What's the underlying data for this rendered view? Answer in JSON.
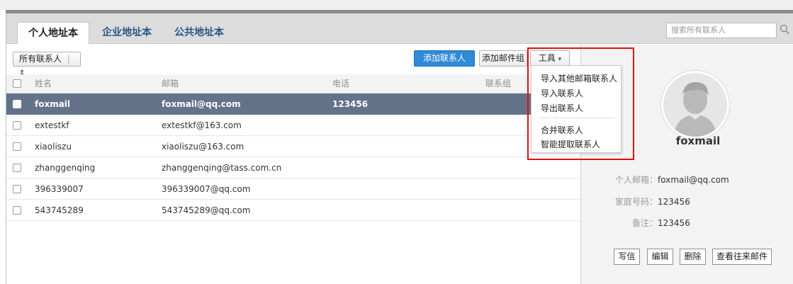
{
  "tabs": [
    {
      "label": "个人地址本",
      "active": true
    },
    {
      "label": "企业地址本",
      "active": false
    },
    {
      "label": "公共地址本",
      "active": false
    }
  ],
  "search": {
    "placeholder": "搜索所有联系人"
  },
  "toolbar": {
    "filter_label": "所有联系人",
    "filter_arrow": "⇕",
    "add_contact": "添加联系人",
    "add_group": "添加邮件组",
    "tools": "工具",
    "tools_caret": "▾"
  },
  "table": {
    "headers": {
      "name": "姓名",
      "email": "邮箱",
      "phone": "电话",
      "group": "联系组"
    },
    "rows": [
      {
        "name": "foxmail",
        "email": "foxmail@qq.com",
        "phone": "123456",
        "selected": true
      },
      {
        "name": "extestkf",
        "email": "extestkf@163.com",
        "phone": ""
      },
      {
        "name": "xiaoliszu",
        "email": "xiaoliszu@163.com",
        "phone": ""
      },
      {
        "name": "zhanggenqing",
        "email": "zhanggenqing@tass.com.cn",
        "phone": ""
      },
      {
        "name": "396339007",
        "email": "396339007@qq.com",
        "phone": ""
      },
      {
        "name": "543745289",
        "email": "543745289@qq.com",
        "phone": ""
      }
    ]
  },
  "tools_menu": {
    "items": [
      "导入其他邮箱联系人",
      "导入联系人",
      "导出联系人",
      "合并联系人",
      "智能提取联系人"
    ]
  },
  "detail": {
    "name": "foxmail",
    "personal_email_label": "个人邮箱：",
    "personal_email": "foxmail@qq.com",
    "home_phone_label": "家庭号码：",
    "home_phone": "123456",
    "note_label": "备注：",
    "note": "123456",
    "actions": [
      "写信",
      "编辑",
      "删除",
      "查看往来邮件"
    ]
  },
  "colors": {
    "selected_row": "#64728a",
    "primary_button": "#2f8ad8",
    "highlight_box": "#e60d0d",
    "tab_text": "#2a5587"
  },
  "icons": {
    "search": "search-icon",
    "avatar": "avatar-placeholder-icon"
  }
}
